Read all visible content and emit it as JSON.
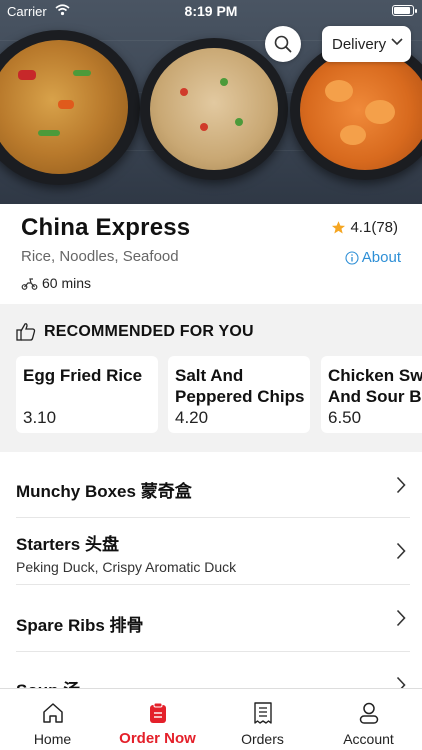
{
  "status_bar": {
    "carrier": "Carrier",
    "time": "8:19 PM",
    "battery_level": 0.95
  },
  "header": {
    "delivery_label": "Delivery",
    "search_icon": "search-icon"
  },
  "restaurant": {
    "name": "China Express",
    "cuisine": "Rice, Noodles, Seafood",
    "eta": "60 mins",
    "rating": "4.1(78)",
    "about_label": "About"
  },
  "recommended": {
    "heading": "RECOMMENDED FOR YOU",
    "items": [
      {
        "name": "Egg Fried Rice",
        "price": "3.10"
      },
      {
        "name": "Salt And\nPeppered Chips",
        "price": "4.20"
      },
      {
        "name": "Chicken Sweet\nAnd Sour Balls",
        "price": "6.50"
      }
    ]
  },
  "menu": [
    {
      "title": "Munchy Boxes 蒙奇盒",
      "subtitle": ""
    },
    {
      "title": "Starters 头盘",
      "subtitle": "Peking Duck, Crispy Aromatic Duck"
    },
    {
      "title": "Spare Ribs 排骨",
      "subtitle": ""
    },
    {
      "title": "Soup 汤",
      "subtitle": ""
    }
  ],
  "tabs": [
    {
      "label": "Home",
      "icon": "home-icon",
      "active": false
    },
    {
      "label": "Order Now",
      "icon": "order-bag-icon",
      "active": true
    },
    {
      "label": "Orders",
      "icon": "receipt-icon",
      "active": false
    },
    {
      "label": "Account",
      "icon": "user-icon",
      "active": false
    }
  ],
  "colors": {
    "accent": "#e4202a",
    "link": "#2e8fd6",
    "star": "#f5a623"
  }
}
